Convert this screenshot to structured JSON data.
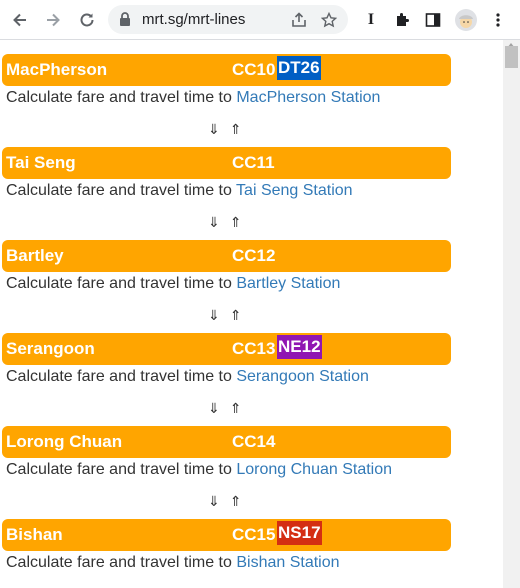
{
  "browser": {
    "url": "mrt.sg/mrt-lines",
    "profile_avatar": "avatar-icon"
  },
  "fare_prefix": "Calculate fare and travel time to",
  "arrows": {
    "down": "⇓",
    "up": "⇑"
  },
  "colors": {
    "bar": "#ffa500",
    "DT": "#005ec4",
    "NE": "#9016b2",
    "NS": "#d42e12",
    "link": "#337ab7"
  },
  "stations": [
    {
      "name": "MacPherson",
      "code": "CC10",
      "xfer": "DT26",
      "xfer_line": "DT",
      "link": "MacPherson Station"
    },
    {
      "name": "Tai Seng",
      "code": "CC11",
      "xfer": "",
      "xfer_line": "",
      "link": "Tai Seng Station"
    },
    {
      "name": "Bartley",
      "code": "CC12",
      "xfer": "",
      "xfer_line": "",
      "link": "Bartley Station"
    },
    {
      "name": "Serangoon",
      "code": "CC13",
      "xfer": "NE12",
      "xfer_line": "NE",
      "link": "Serangoon Station"
    },
    {
      "name": "Lorong Chuan",
      "code": "CC14",
      "xfer": "",
      "xfer_line": "",
      "link": "Lorong Chuan Station"
    },
    {
      "name": "Bishan",
      "code": "CC15",
      "xfer": "NS17",
      "xfer_line": "NS",
      "link": "Bishan Station"
    }
  ]
}
